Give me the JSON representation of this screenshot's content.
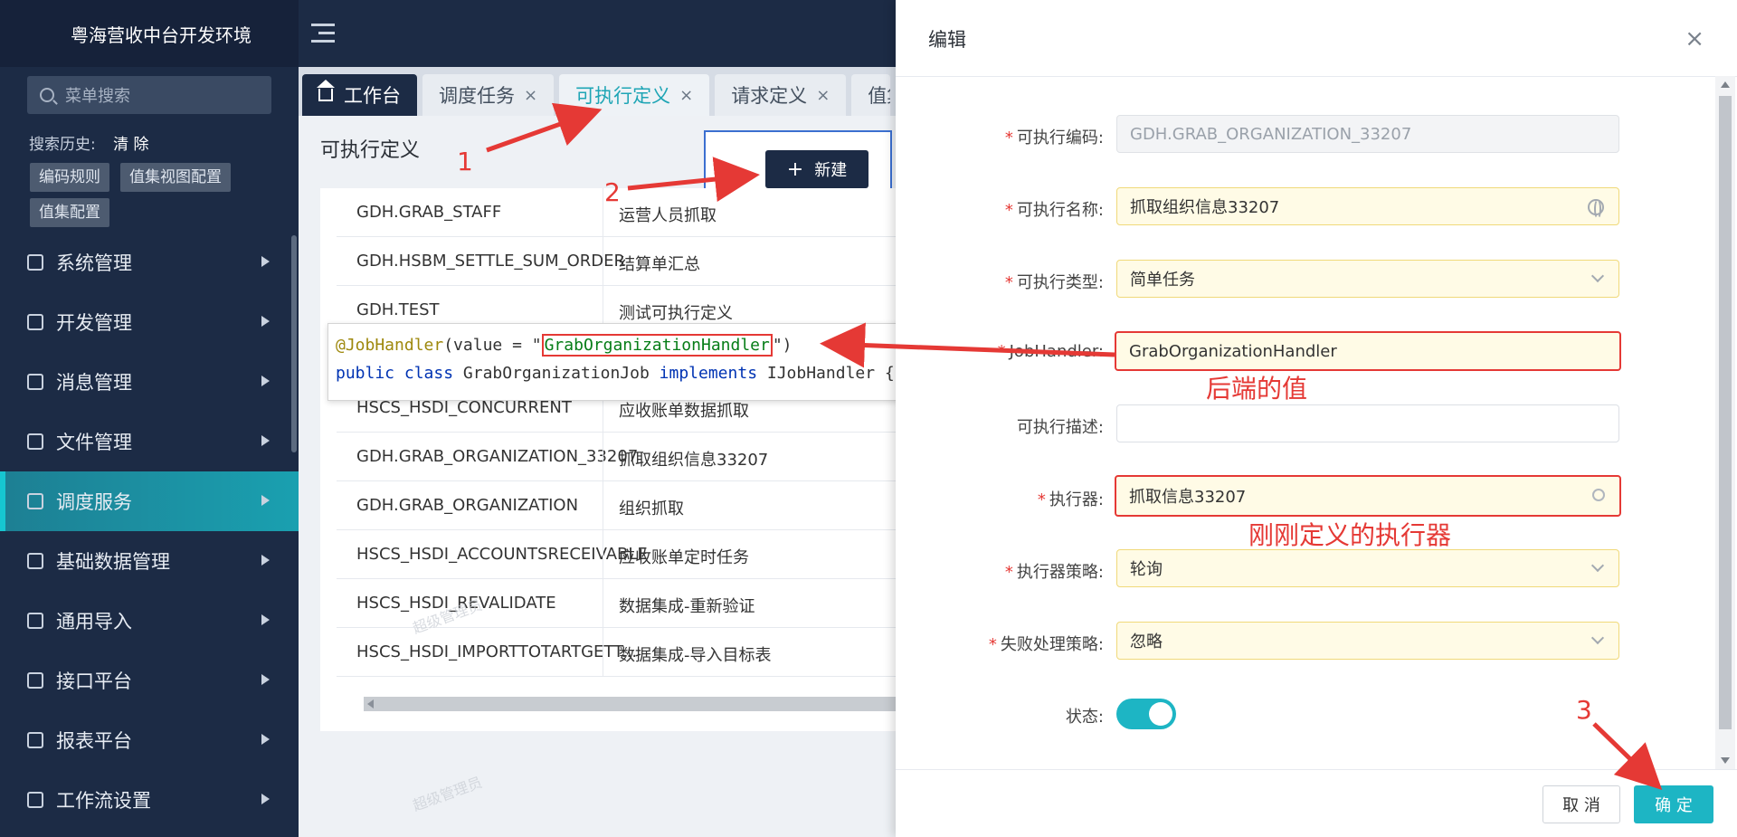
{
  "app": {
    "title": "粤海营收中台开发环境"
  },
  "sidebar": {
    "search_placeholder": "菜单搜索",
    "history_label": "搜索历史:",
    "history_clear": "清 除",
    "history_tags": [
      "编码规则",
      "值集视图配置",
      "值集配置"
    ],
    "items": [
      {
        "label": "系统管理",
        "icon": "monitor-icon"
      },
      {
        "label": "开发管理",
        "icon": "code-icon"
      },
      {
        "label": "消息管理",
        "icon": "message-icon"
      },
      {
        "label": "文件管理",
        "icon": "folder-icon"
      },
      {
        "label": "调度服务",
        "icon": "sliders-icon",
        "active": true
      },
      {
        "label": "基础数据管理",
        "icon": "database-icon"
      },
      {
        "label": "通用导入",
        "icon": "import-icon"
      },
      {
        "label": "接口平台",
        "icon": "interface-icon"
      },
      {
        "label": "报表平台",
        "icon": "report-icon"
      },
      {
        "label": "工作流设置",
        "icon": "workflow-icon"
      }
    ]
  },
  "tabs": [
    {
      "label": "工作台"
    },
    {
      "label": "调度任务",
      "close": "×"
    },
    {
      "label": "可执行定义",
      "close": "×",
      "active": true
    },
    {
      "label": "请求定义",
      "close": "×"
    },
    {
      "label": "值集配"
    }
  ],
  "page": {
    "title": "可执行定义",
    "new_button": "新建",
    "watermark": "超级管理员"
  },
  "table": {
    "rows": [
      {
        "code": "GDH.GRAB_STAFF",
        "name": "运营人员抓取"
      },
      {
        "code": "GDH.HSBM_SETTLE_SUM_ORDER",
        "name": "结算单汇总"
      },
      {
        "code": "GDH.TEST",
        "name": "测试可执行定义"
      },
      {
        "code": "",
        "name": ""
      },
      {
        "code": "HSCS_HSDI_CONCURRENT",
        "name": "应收账单数据抓取"
      },
      {
        "code": "GDH.GRAB_ORGANIZATION_33207",
        "name": "抓取组织信息33207"
      },
      {
        "code": "GDH.GRAB_ORGANIZATION",
        "name": "组织抓取"
      },
      {
        "code": "HSCS_HSDI_ACCOUNTSRECEIVABLE",
        "name": "应收账单定时任务"
      },
      {
        "code": "HSCS_HSDI_REVALIDATE",
        "name": "数据集成-重新验证"
      },
      {
        "code": "HSCS_HSDI_IMPORTTOTARTGETT...",
        "name": "数据集成-导入目标表"
      }
    ]
  },
  "code_snippet": {
    "line1_annotation": "@JobHandler",
    "line1_mid": "(value = \"",
    "line1_value": "GrabOrganizationHandler",
    "line1_end": "\")",
    "line2_kw1": "public",
    "line2_kw2": "class",
    "line2_name": "GrabOrganizationJob",
    "line2_kw3": "implements",
    "line2_iface": "IJobHandler {"
  },
  "dialog": {
    "title": "编辑",
    "close": "×",
    "fields": {
      "code_label": "可执行编码:",
      "code_value": "GDH.GRAB_ORGANIZATION_33207",
      "name_label": "可执行名称:",
      "name_value": "抓取组织信息33207",
      "type_label": "可执行类型:",
      "type_value": "简单任务",
      "handler_label": "JobHandler:",
      "handler_value": "GrabOrganizationHandler",
      "desc_label": "可执行描述:",
      "desc_value": "",
      "executor_label": "执行器:",
      "executor_value": "抓取信息33207",
      "strategy_label": "执行器策略:",
      "strategy_value": "轮询",
      "fail_label": "失败处理策略:",
      "fail_value": "忽略",
      "status_label": "状态:",
      "status_on": true
    },
    "cancel": "取 消",
    "ok": "确 定"
  },
  "annotations": {
    "step1": "1",
    "step2": "2",
    "step3": "3",
    "backend_value": "后端的值",
    "just_defined": "刚刚定义的执行器",
    "color": "#e53935"
  }
}
